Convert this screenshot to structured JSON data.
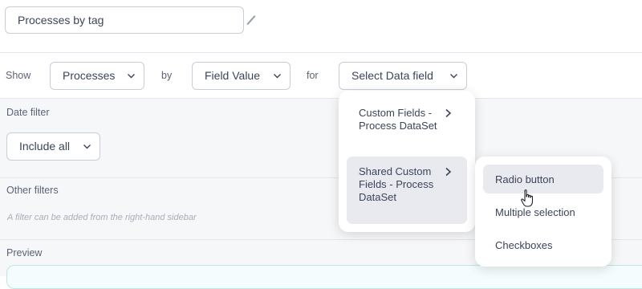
{
  "report": {
    "title": "Processes by tag"
  },
  "config_row": {
    "show_label": "Show",
    "show_value": "Processes",
    "by_label": "by",
    "by_value": "Field Value",
    "for_label": "for",
    "for_value": "Select Data field"
  },
  "date_filter": {
    "label": "Date filter",
    "value": "Include all"
  },
  "other_filters": {
    "label": "Other filters",
    "hint": "A filter can be added from the right-hand sidebar"
  },
  "preview": {
    "label": "Preview"
  },
  "data_field_menu": {
    "items": [
      "Custom Fields - Process DataSet",
      "Shared Custom Fields - Process DataSet"
    ]
  },
  "submenu": {
    "items": [
      "Radio button",
      "Multiple selection",
      "Checkboxes"
    ]
  }
}
